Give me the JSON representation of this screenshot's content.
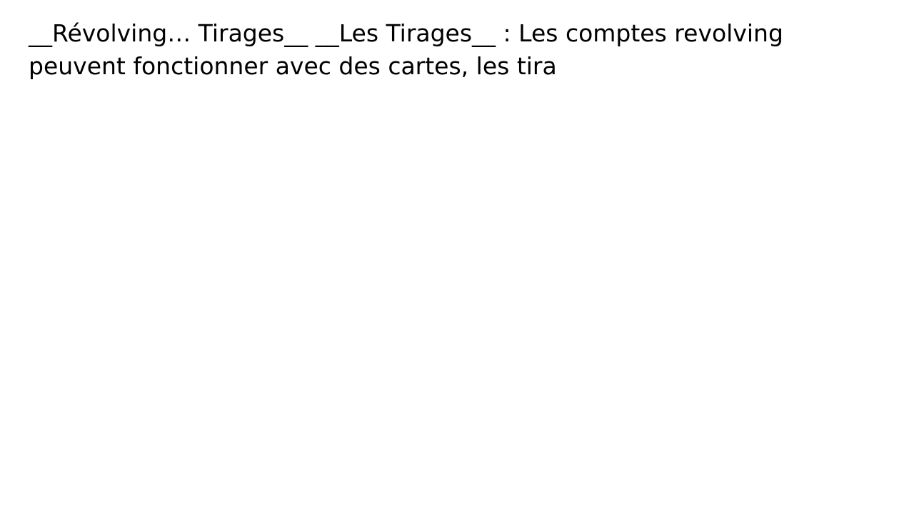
{
  "document": {
    "text": "__Révolving… Tirages__ __Les Tirages__ : Les comptes revolving peuvent fonctionner avec des cartes, les tira"
  },
  "colors": {
    "background": "#ffffff",
    "text": "#000000"
  }
}
